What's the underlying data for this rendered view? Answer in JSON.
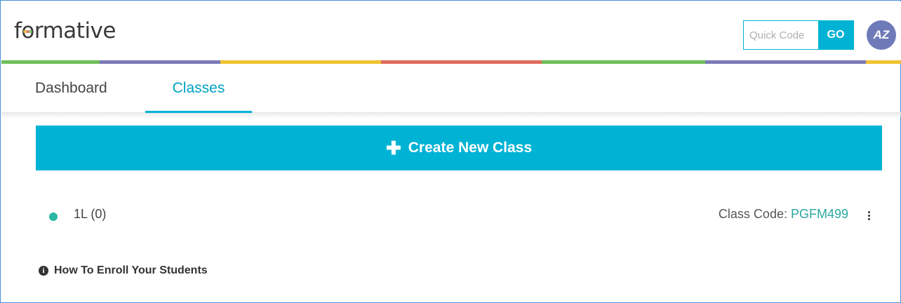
{
  "header": {
    "logo_text_pre": "f",
    "logo_text_o": "o",
    "logo_text_post": "rmative",
    "quick_code": {
      "placeholder": "Quick Code",
      "value": ""
    },
    "go_label": "GO",
    "avatar_initials": "AZ"
  },
  "stripe_colors": [
    "#6fbf5a",
    "#7a7ab8",
    "#f1c232",
    "#e06c5b",
    "#6fbf5a",
    "#7a7ab8",
    "#f1c232"
  ],
  "tabs": [
    {
      "label": "Dashboard",
      "active": false
    },
    {
      "label": "Classes",
      "active": true
    }
  ],
  "main": {
    "create_button": {
      "icon": "plus-icon",
      "label": "Create New Class"
    },
    "classes": [
      {
        "name": "1L (0)",
        "status_color": "#2ab8a5",
        "code_label": "Class Code: ",
        "code": "PGFM499"
      }
    ],
    "enroll": {
      "icon": "info-icon",
      "label": "How To Enroll Your Students"
    }
  },
  "colors": {
    "accent": "#00b3d4",
    "avatar": "#6f7bb8",
    "class_dot": "#2ab8a5"
  }
}
